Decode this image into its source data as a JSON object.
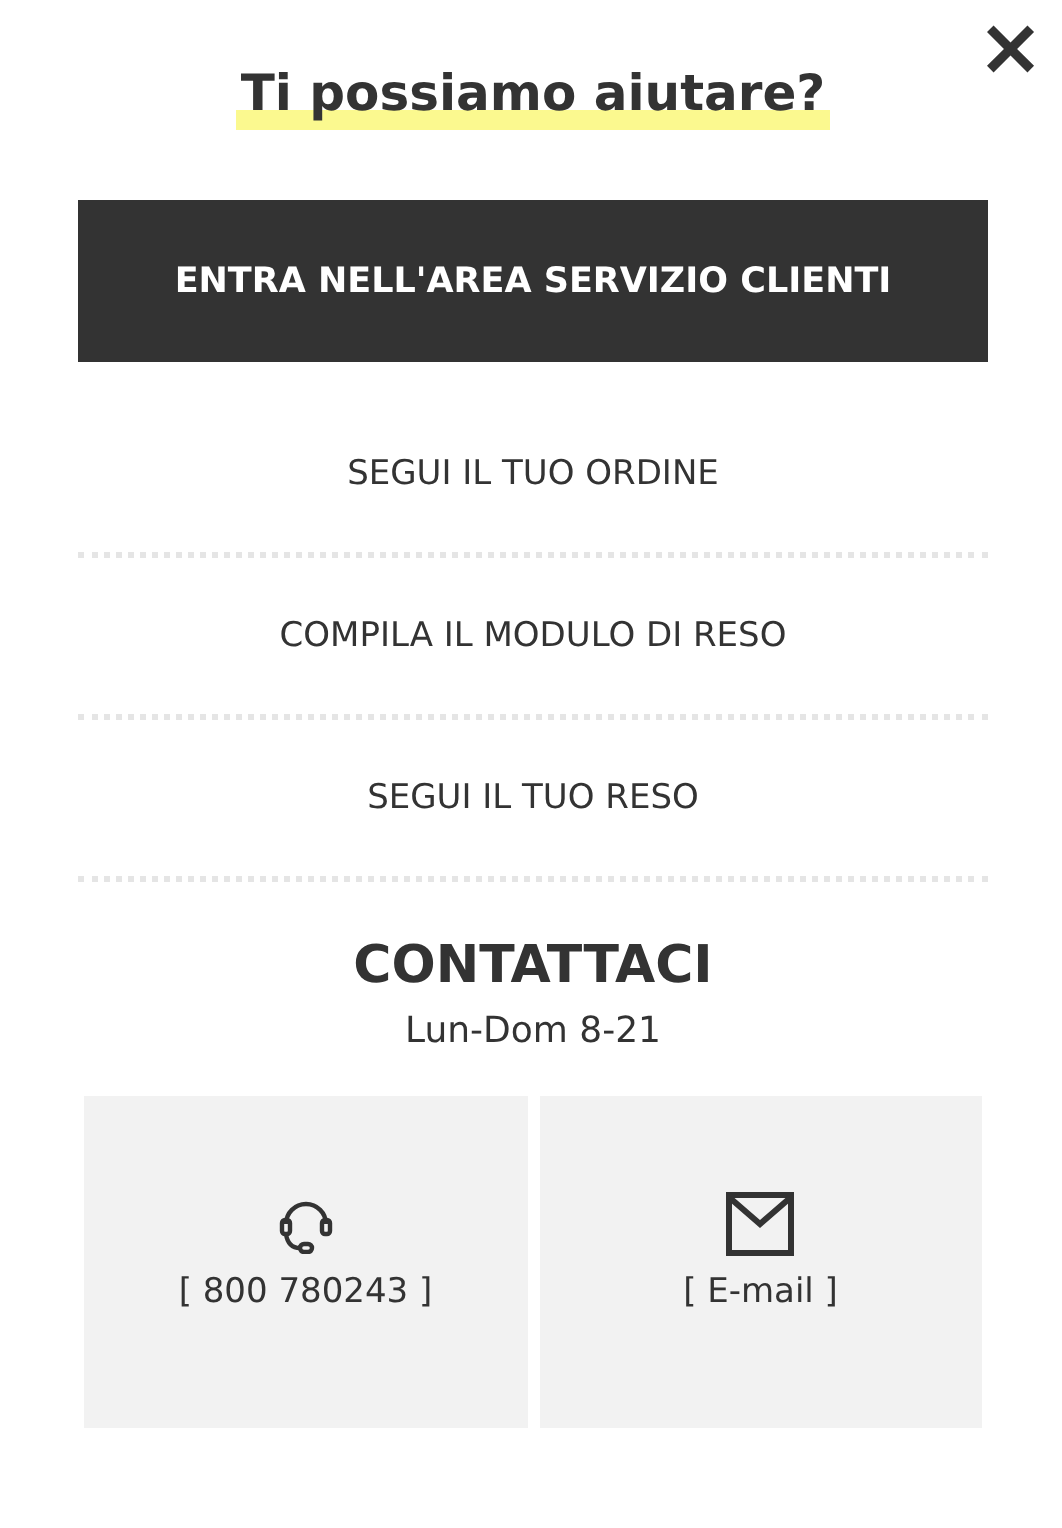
{
  "close": "×",
  "title": "Ti possiamo aiutare?",
  "primary_button": "ENTRA NELL'AREA SERVIZIO CLIENTI",
  "links": [
    {
      "label": "SEGUI IL TUO ORDINE"
    },
    {
      "label": "COMPILA IL MODULO DI RESO"
    },
    {
      "label": "SEGUI IL TUO RESO"
    }
  ],
  "contact": {
    "heading": "CONTATTACI",
    "hours": "Lun-Dom 8-21",
    "options": [
      {
        "kind": "phone",
        "label": "[ 800 780243 ]"
      },
      {
        "kind": "email",
        "label": "[ E-mail ]"
      }
    ]
  }
}
